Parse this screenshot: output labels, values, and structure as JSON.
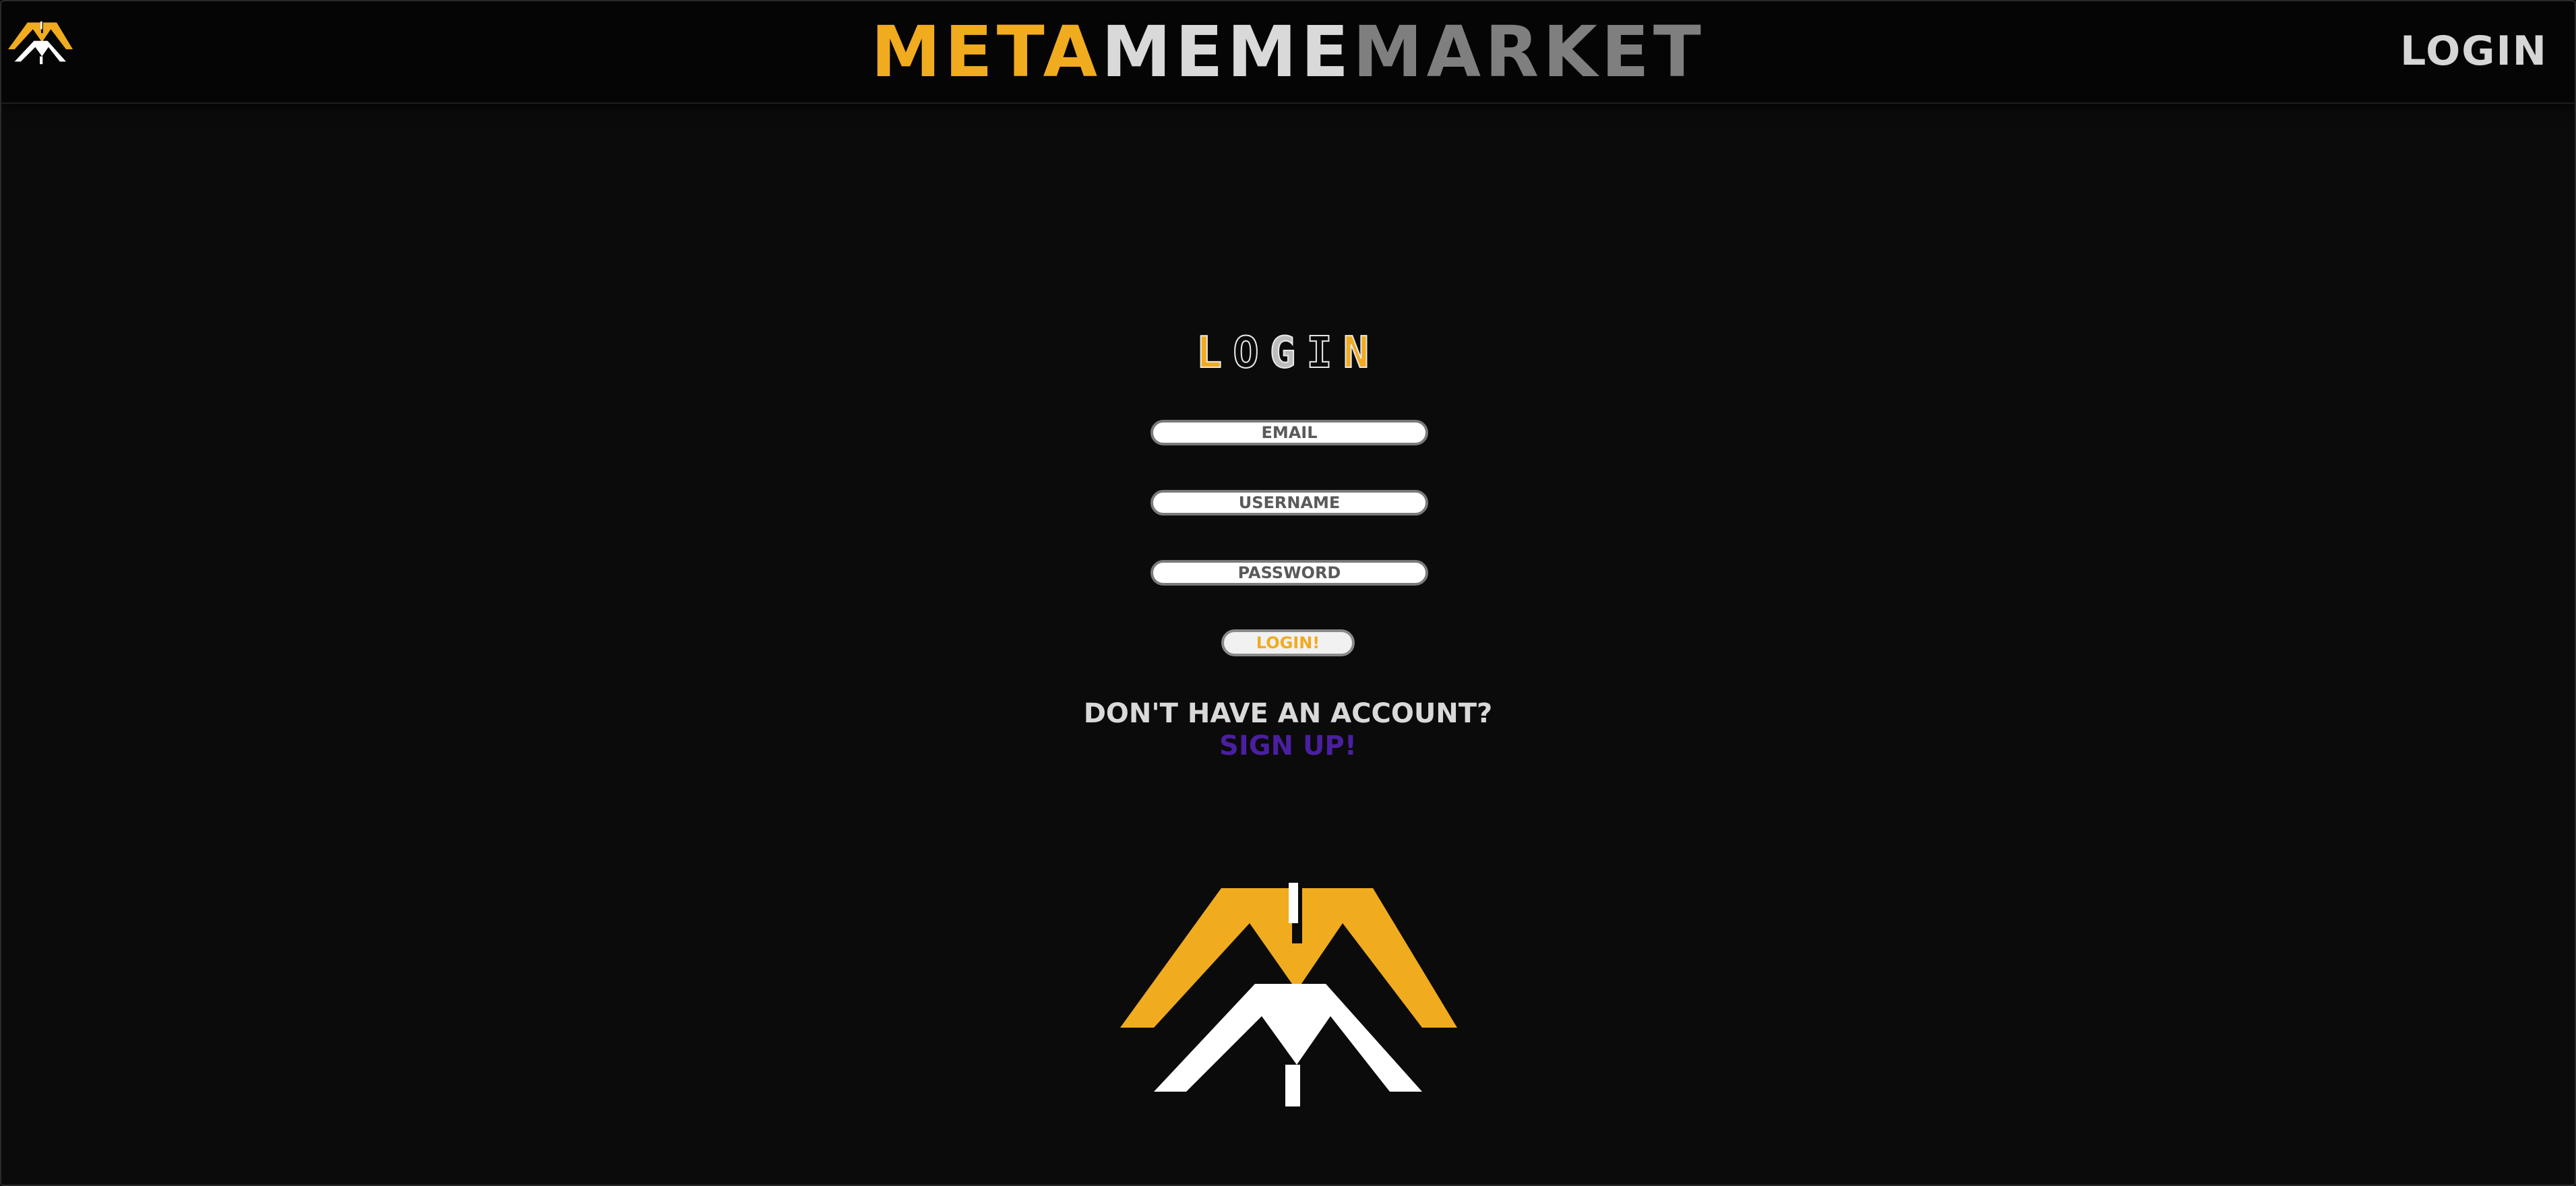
{
  "colors": {
    "background": "#0b0b0b",
    "navbar": "#050505",
    "accent_yellow": "#f0ab1f",
    "white": "#ffffff",
    "light_gray": "#d6d6d6",
    "mid_gray": "#7f7f7f",
    "purple": "#4a1fa0"
  },
  "navbar": {
    "logo_icon": "mm-logo-icon",
    "brand": {
      "meta": "META",
      "meme": "MEME",
      "market": "MARKET"
    },
    "login_label": "LOGIN"
  },
  "login_form": {
    "title_letters": [
      "L",
      "O",
      "G",
      "I",
      "N"
    ],
    "email_placeholder": "EMAIL",
    "username_placeholder": "USERNAME",
    "password_placeholder": "PASSWORD",
    "submit_label": "LOGIN!",
    "no_account_text": "DON'T HAVE AN ACCOUNT?",
    "signup_label": "SIGN UP!"
  },
  "footer_logo": {
    "icon": "mm-logo-icon"
  }
}
